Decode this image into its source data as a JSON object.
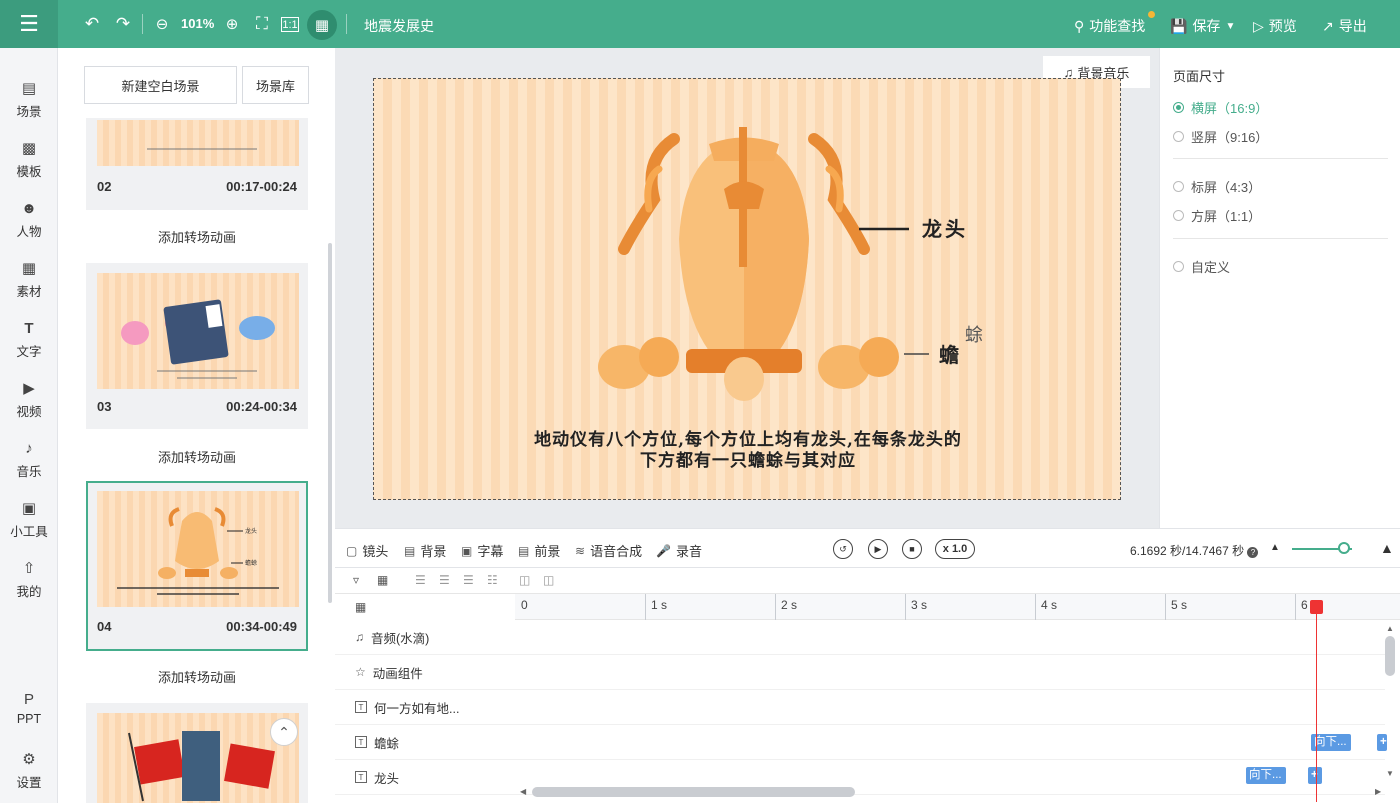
{
  "topbar": {
    "zoom": "101%",
    "doc_title": "地震发展史",
    "find_label": "功能查找",
    "save_label": "保存",
    "preview_label": "预览",
    "export_label": "导出"
  },
  "nav": {
    "items": [
      {
        "label": "场景",
        "icon": "scene-icon"
      },
      {
        "label": "模板",
        "icon": "template-icon"
      },
      {
        "label": "人物",
        "icon": "person-icon"
      },
      {
        "label": "素材",
        "icon": "material-icon"
      },
      {
        "label": "文字",
        "icon": "text-icon"
      },
      {
        "label": "视频",
        "icon": "video-icon"
      },
      {
        "label": "音乐",
        "icon": "music-icon"
      },
      {
        "label": "小工具",
        "icon": "toolbox-icon"
      },
      {
        "label": "我的",
        "icon": "upload-icon"
      },
      {
        "label": "PPT",
        "icon": "ppt-icon"
      },
      {
        "label": "设置",
        "icon": "gear-icon"
      }
    ]
  },
  "scenes": {
    "new_blank": "新建空白场景",
    "library": "场景库",
    "add_transition": "添加转场动画",
    "list": [
      {
        "num": "02",
        "time": "00:17-00:24"
      },
      {
        "num": "03",
        "time": "00:24-00:34"
      },
      {
        "num": "04",
        "time": "00:34-00:49"
      }
    ],
    "thumb_04_label_a": "龙头",
    "thumb_04_label_b": "蟾蜍"
  },
  "canvas": {
    "bg_music": "背景音乐",
    "label_dragon": "龙头",
    "label_toad_a": "蟾",
    "label_toad_b": "蜍",
    "caption_line1": "地动仪有八个方位,每个方位上均有龙头,在每条龙头的",
    "caption_line2": "下方都有一只蟾蜍与其对应"
  },
  "props": {
    "title": "页面尺寸",
    "options": [
      "横屏（16:9）",
      "竖屏（9:16）",
      "标屏（4:3）",
      "方屏（1:1）",
      "自定义"
    ],
    "selected": 0
  },
  "timeline": {
    "tabs": [
      "镜头",
      "背景",
      "字幕",
      "前景",
      "语音合成",
      "录音"
    ],
    "speed": "x 1.0",
    "time_info": "6.1692 秒/14.7467 秒",
    "ticks": [
      "0",
      "1 s",
      "2 s",
      "3 s",
      "4 s",
      "5 s",
      "6"
    ],
    "tracks": [
      "音频(水滴)",
      "动画组件",
      "何一方如有地...",
      "蟾蜍",
      "龙头"
    ],
    "clip_toad": "向下...",
    "clip_dragon": "向下..."
  },
  "colors": {
    "accent": "#45ad8c",
    "clip": "#5b9ae3",
    "playhead": "#ee3333"
  }
}
